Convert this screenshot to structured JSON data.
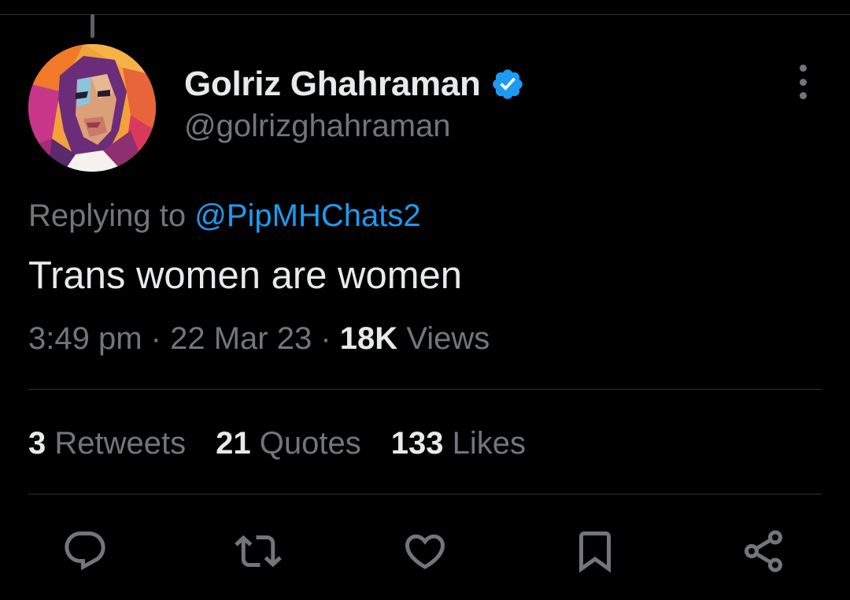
{
  "author": {
    "display_name": "Golriz Ghahraman",
    "handle": "@golrizghahraman",
    "verified_icon": "verified-badge-icon"
  },
  "reply": {
    "prefix": "Replying to",
    "mention": "@PipMHChats2"
  },
  "tweet": {
    "text": "Trans women are women",
    "time": "3:49 pm",
    "separator": "·",
    "date": "22 Mar 23",
    "views_count": "18K",
    "views_label": "Views"
  },
  "stats": {
    "retweets_count": "3",
    "retweets_label": "Retweets",
    "quotes_count": "21",
    "quotes_label": "Quotes",
    "likes_count": "133",
    "likes_label": "Likes"
  },
  "actions": [
    "reply-icon",
    "retweet-icon",
    "like-icon",
    "bookmark-icon",
    "share-icon"
  ],
  "colors": {
    "background": "#000000",
    "primary_text": "#e7e9ea",
    "secondary_text": "#71767b",
    "accent": "#1d9bf0",
    "divider": "#2f3336"
  }
}
